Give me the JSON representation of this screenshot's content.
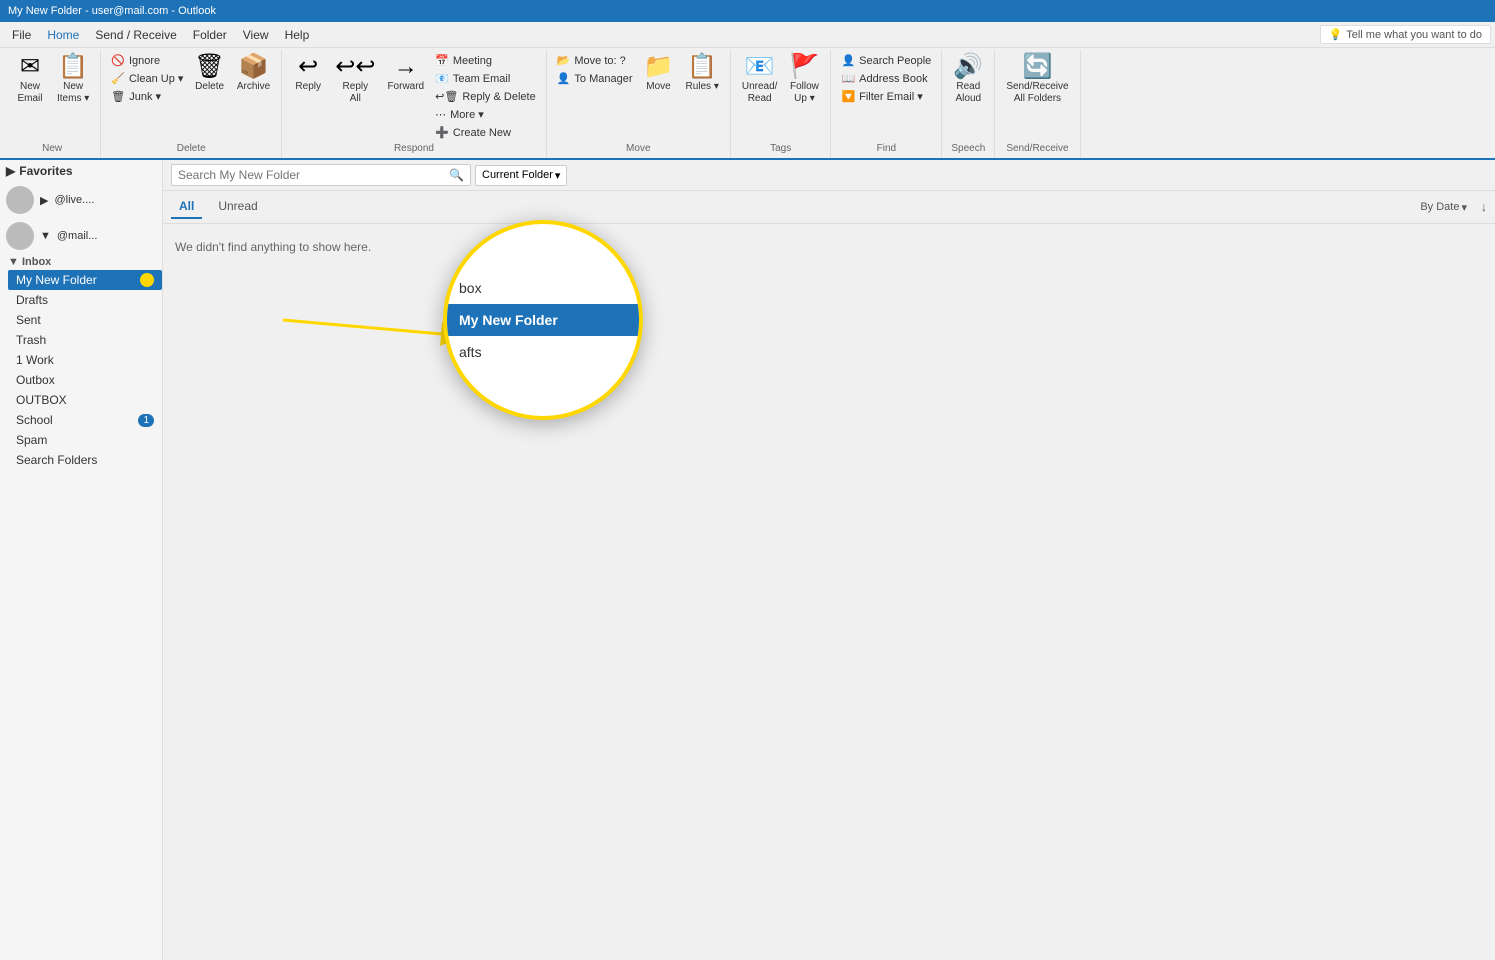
{
  "titleBar": {
    "title": "My New Folder - user@mail.com - Outlook"
  },
  "menuBar": {
    "items": [
      "File",
      "Home",
      "Send / Receive",
      "Folder",
      "View",
      "Help"
    ],
    "activeItem": "Home",
    "tellMe": "Tell me what you want to do",
    "lightbulbIcon": "💡"
  },
  "ribbon": {
    "groups": [
      {
        "label": "New",
        "items": [
          {
            "id": "new-email",
            "icon": "✉",
            "label": "New\nEmail"
          },
          {
            "id": "new-items",
            "icon": "📋",
            "label": "New\nItems ▾"
          }
        ]
      },
      {
        "label": "Delete",
        "items": [
          {
            "id": "ignore",
            "icon": "🚫",
            "label": "Ignore",
            "small": true
          },
          {
            "id": "clean-up",
            "icon": "🧹",
            "label": "Clean Up ▾",
            "small": true
          },
          {
            "id": "junk",
            "icon": "🗑",
            "label": "Junk ▾",
            "small": true
          },
          {
            "id": "delete",
            "icon": "🗑",
            "label": "Delete"
          },
          {
            "id": "archive",
            "icon": "📦",
            "label": "Archive"
          }
        ]
      },
      {
        "label": "Respond",
        "items": [
          {
            "id": "reply",
            "icon": "↩",
            "label": "Reply"
          },
          {
            "id": "reply-all",
            "icon": "↩↩",
            "label": "Reply\nAll"
          },
          {
            "id": "forward",
            "icon": "→",
            "label": "Forward"
          },
          {
            "id": "meeting",
            "icon": "📅",
            "label": "Meeting",
            "small": true
          },
          {
            "id": "team-email",
            "icon": "📧",
            "label": "Team Email",
            "small": true
          },
          {
            "id": "reply-delete",
            "icon": "↩🗑",
            "label": "Reply & Delete",
            "small": true
          },
          {
            "id": "more",
            "icon": "⋯",
            "label": "More ▾",
            "small": true
          },
          {
            "id": "create-new",
            "icon": "➕",
            "label": "Create New",
            "small": true
          }
        ]
      },
      {
        "label": "Move",
        "items": [
          {
            "id": "move-to",
            "icon": "📂",
            "label": "Move to: ?",
            "small": true
          },
          {
            "id": "to-manager",
            "icon": "👤",
            "label": "To Manager",
            "small": true
          },
          {
            "id": "move",
            "icon": "📁",
            "label": "Move"
          },
          {
            "id": "rules",
            "icon": "📋",
            "label": "Rules ▾"
          }
        ]
      },
      {
        "label": "Tags",
        "items": [
          {
            "id": "unread-read",
            "icon": "📧",
            "label": "Unread/\nRead"
          },
          {
            "id": "follow-up",
            "icon": "🚩",
            "label": "Follow\nUp ▾"
          }
        ]
      },
      {
        "label": "Find",
        "items": [
          {
            "id": "search-people",
            "icon": "👤",
            "label": "Search People",
            "small": true
          },
          {
            "id": "address-book",
            "icon": "📖",
            "label": "Address Book",
            "small": true
          },
          {
            "id": "filter-email",
            "icon": "🔽",
            "label": "Filter Email ▾",
            "small": true
          }
        ]
      },
      {
        "label": "Speech",
        "items": [
          {
            "id": "read-aloud",
            "icon": "🔊",
            "label": "Read\nAloud"
          }
        ]
      },
      {
        "label": "Send/Receive",
        "items": [
          {
            "id": "send-receive-all",
            "icon": "🔄",
            "label": "Send/Receive\nAll Folders"
          }
        ]
      }
    ]
  },
  "sidebar": {
    "collapseIcon": "◀",
    "favorites": {
      "label": "Favorites",
      "expandIcon": "▶"
    },
    "accounts": [
      {
        "id": "account-live",
        "email": "@live....",
        "expandIcon": "▶"
      },
      {
        "id": "account-mail",
        "email": "@mail...",
        "expandIcon": "▼",
        "folders": {
          "inboxLabel": "Inbox",
          "items": [
            {
              "id": "my-new-folder",
              "name": "My New Folder",
              "selected": true
            },
            {
              "id": "drafts",
              "name": "Drafts"
            },
            {
              "id": "sent",
              "name": "Sent"
            },
            {
              "id": "trash",
              "name": "Trash"
            },
            {
              "id": "1-work",
              "name": "1 Work"
            },
            {
              "id": "outbox",
              "name": "Outbox"
            },
            {
              "id": "outbox2",
              "name": "OUTBOX"
            },
            {
              "id": "school",
              "name": "School",
              "badge": "1"
            },
            {
              "id": "spam",
              "name": "Spam"
            },
            {
              "id": "search-folders",
              "name": "Search Folders"
            }
          ]
        }
      }
    ]
  },
  "searchBar": {
    "placeholder": "Search My New Folder",
    "scopeLabel": "Current Folder",
    "scopeDropdownIcon": "▾"
  },
  "emailList": {
    "filters": [
      "All",
      "Unread"
    ],
    "activeFilter": "All",
    "sortLabel": "By Date",
    "sortDropdownIcon": "▾",
    "sortArrow": "↓",
    "emptyMessage": "We didn't find anything to show here."
  },
  "magnifiedPopup": {
    "items": [
      {
        "label": "box",
        "highlighted": false
      },
      {
        "label": "My New Folder",
        "highlighted": true
      },
      {
        "label": "afts",
        "highlighted": false
      }
    ]
  },
  "colors": {
    "accent": "#1e72b8",
    "highlight": "#ffd700",
    "selectedBg": "#1e72b8",
    "selectedText": "#ffffff"
  }
}
